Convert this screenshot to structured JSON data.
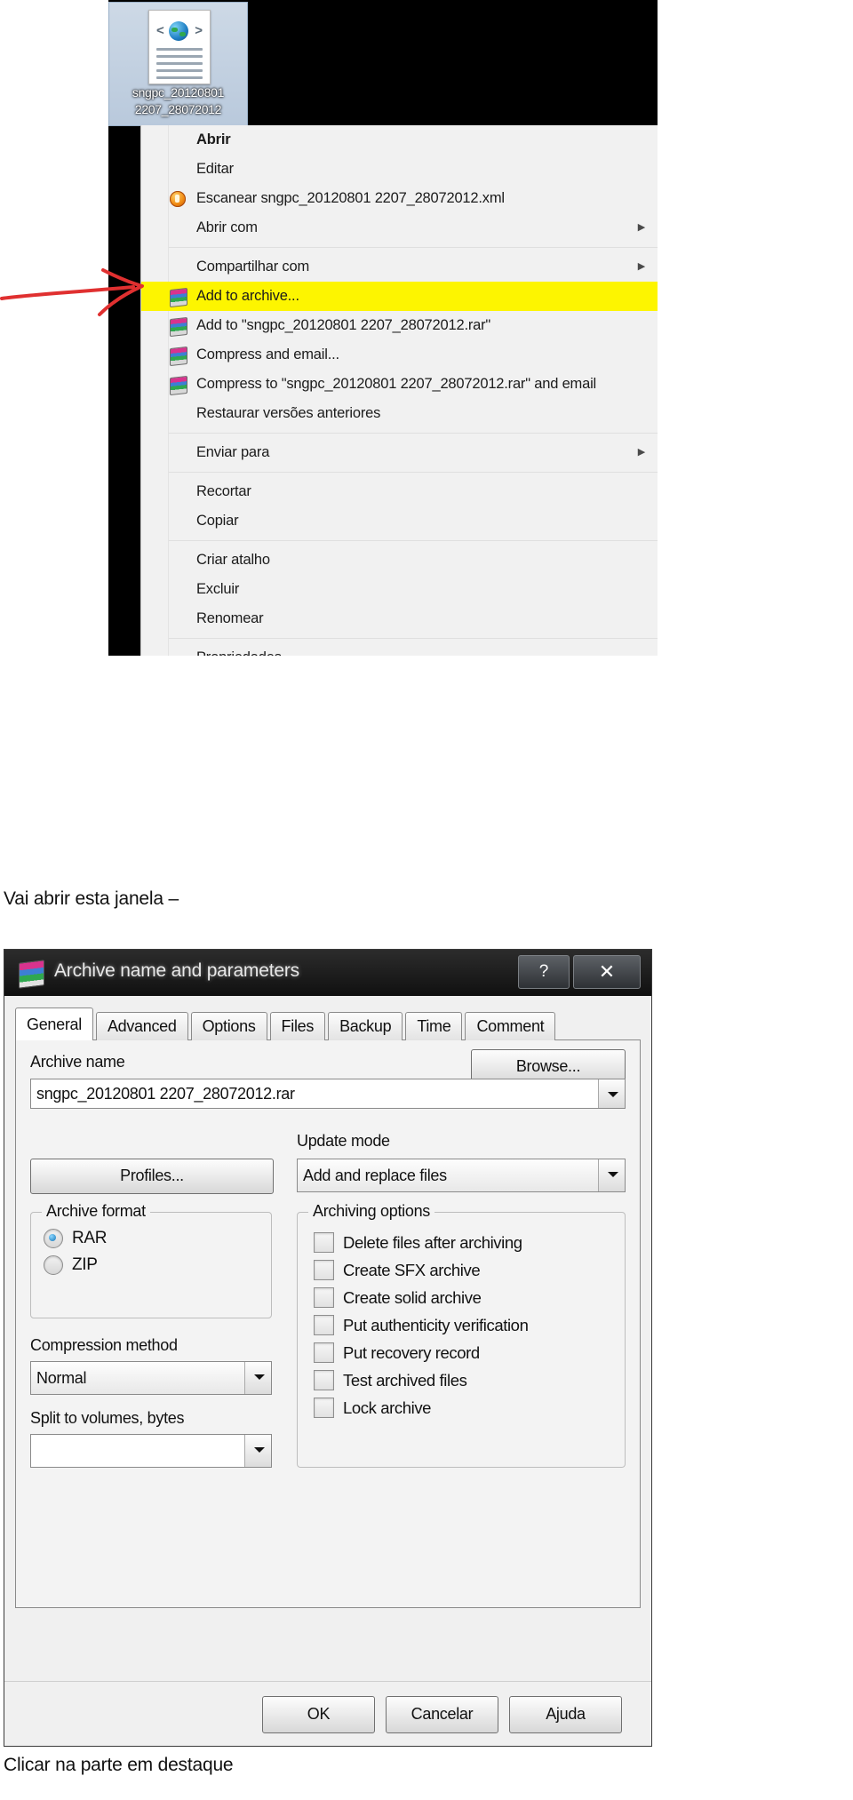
{
  "desktop": {
    "file_icon_name": "xml-file-icon",
    "file_label_line1": "sngpc_20120801",
    "file_label_line2": "2207_28072012"
  },
  "context_menu": {
    "items": [
      {
        "label": "Abrir",
        "bold": true,
        "icon": null,
        "submenu": false,
        "highlight": false
      },
      {
        "label": "Editar",
        "bold": false,
        "icon": null,
        "submenu": false,
        "highlight": false
      },
      {
        "label": "Escanear sngpc_20120801 2207_28072012.xml",
        "bold": false,
        "icon": "avast-scan-icon",
        "submenu": false,
        "highlight": false
      },
      {
        "label": "Abrir com",
        "bold": false,
        "icon": null,
        "submenu": true,
        "highlight": false
      },
      {
        "separator": true
      },
      {
        "label": "Compartilhar com",
        "bold": false,
        "icon": null,
        "submenu": true,
        "highlight": false
      },
      {
        "label": "Add to archive...",
        "bold": false,
        "icon": "winrar-icon",
        "submenu": false,
        "highlight": true
      },
      {
        "label": "Add to \"sngpc_20120801 2207_28072012.rar\"",
        "bold": false,
        "icon": "winrar-icon",
        "submenu": false,
        "highlight": false
      },
      {
        "label": "Compress and email...",
        "bold": false,
        "icon": "winrar-icon",
        "submenu": false,
        "highlight": false
      },
      {
        "label": "Compress to \"sngpc_20120801 2207_28072012.rar\" and email",
        "bold": false,
        "icon": "winrar-icon",
        "submenu": false,
        "highlight": false
      },
      {
        "label": "Restaurar versões anteriores",
        "bold": false,
        "icon": null,
        "submenu": false,
        "highlight": false
      },
      {
        "separator": true
      },
      {
        "label": "Enviar para",
        "bold": false,
        "icon": null,
        "submenu": true,
        "highlight": false
      },
      {
        "separator": true
      },
      {
        "label": "Recortar",
        "bold": false,
        "icon": null,
        "submenu": false,
        "highlight": false
      },
      {
        "label": "Copiar",
        "bold": false,
        "icon": null,
        "submenu": false,
        "highlight": false
      },
      {
        "separator": true
      },
      {
        "label": "Criar atalho",
        "bold": false,
        "icon": null,
        "submenu": false,
        "highlight": false
      },
      {
        "label": "Excluir",
        "bold": false,
        "icon": null,
        "submenu": false,
        "highlight": false
      },
      {
        "label": "Renomear",
        "bold": false,
        "icon": null,
        "submenu": false,
        "highlight": false
      },
      {
        "separator": true
      },
      {
        "label": "Propriedades",
        "bold": false,
        "icon": null,
        "submenu": false,
        "highlight": false
      }
    ],
    "highlight_color": "#fdf500",
    "annotation_arrow_color": "#e03030"
  },
  "captions": {
    "top": "Vai abrir esta janela –",
    "bottom": "Clicar na parte em destaque"
  },
  "dialog": {
    "title": "Archive name and parameters",
    "help_button": "?",
    "close_button": "✕",
    "tabs": [
      {
        "label": "General",
        "active": true
      },
      {
        "label": "Advanced",
        "active": false
      },
      {
        "label": "Options",
        "active": false
      },
      {
        "label": "Files",
        "active": false
      },
      {
        "label": "Backup",
        "active": false
      },
      {
        "label": "Time",
        "active": false
      },
      {
        "label": "Comment",
        "active": false
      }
    ],
    "archive_name_label": "Archive name",
    "archive_name_value": "sngpc_20120801 2207_28072012.rar",
    "browse_button": "Browse...",
    "profiles_button": "Profiles...",
    "update_mode_label": "Update mode",
    "update_mode_value": "Add and replace files",
    "archive_format_legend": "Archive format",
    "archive_format_options": [
      {
        "label": "RAR",
        "selected": true
      },
      {
        "label": "ZIP",
        "selected": false
      }
    ],
    "compression_method_label": "Compression method",
    "compression_method_value": "Normal",
    "split_label": "Split to volumes, bytes",
    "split_value": "",
    "archiving_options_legend": "Archiving options",
    "archiving_options": [
      {
        "label": "Delete files after archiving",
        "checked": false
      },
      {
        "label": "Create SFX archive",
        "checked": false
      },
      {
        "label": "Create solid archive",
        "checked": false
      },
      {
        "label": "Put authenticity verification",
        "checked": false
      },
      {
        "label": "Put recovery record",
        "checked": false
      },
      {
        "label": "Test archived files",
        "checked": false
      },
      {
        "label": "Lock archive",
        "checked": false
      }
    ],
    "ok_button": "OK",
    "cancel_button": "Cancelar",
    "help_button_label": "Ajuda"
  }
}
